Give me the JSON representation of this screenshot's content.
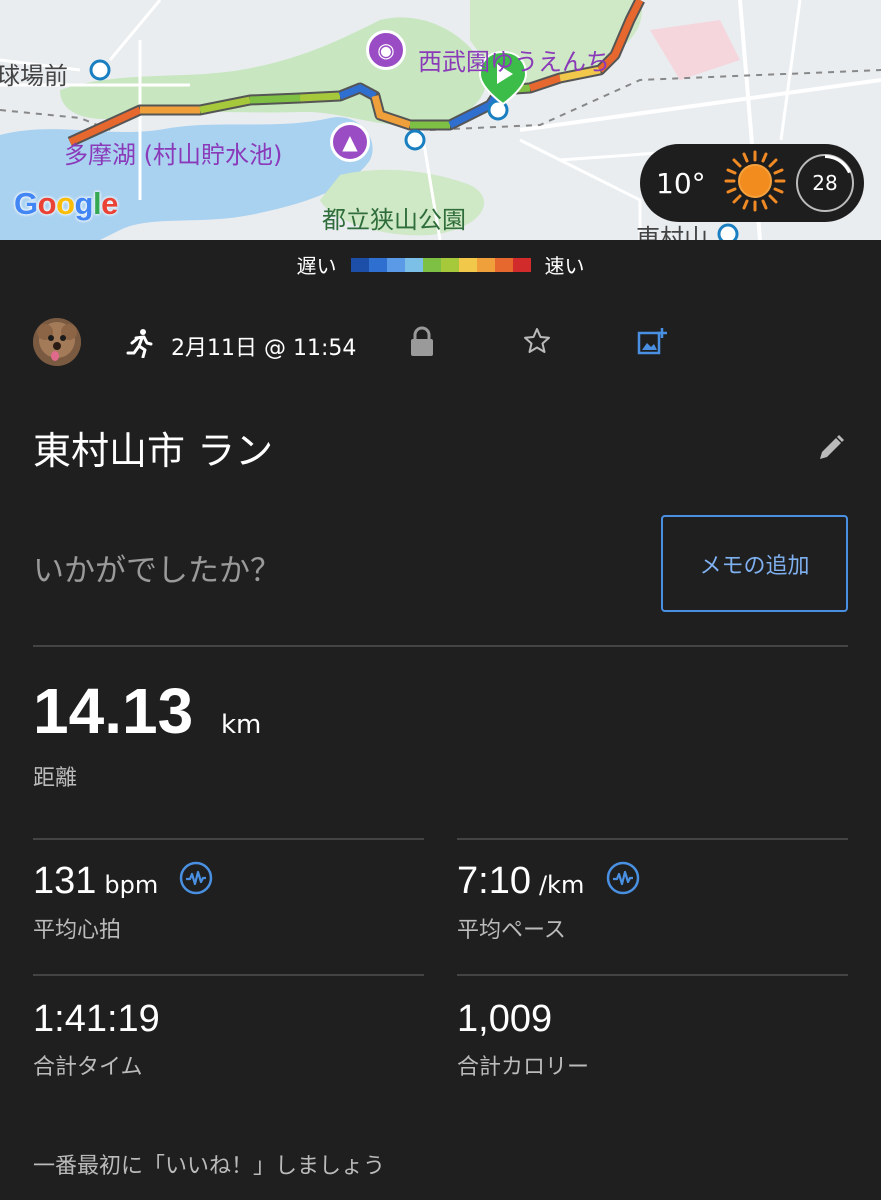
{
  "map": {
    "labels": {
      "kyujo": "球場前",
      "seibuen": "西武園ゆうえんち",
      "tamako": "多摩湖 (村山貯水池)",
      "sayama_park": "都立狭山公園",
      "higashimurayama": "東村山"
    },
    "google_logo": "Google",
    "weather": {
      "temperature": "10°",
      "icon": "sun-icon",
      "gauge_value": "28"
    }
  },
  "legend": {
    "slow": "遅い",
    "fast": "速い",
    "colors": [
      "#1d4fa8",
      "#2f6fcf",
      "#5b9ae6",
      "#7cc0e8",
      "#7dc043",
      "#a5c93b",
      "#f2c84a",
      "#f0a03a",
      "#e6682e",
      "#d12b2b"
    ]
  },
  "activity": {
    "type_icon": "running-icon",
    "date": "2月11日 @ 11:54",
    "title": "東村山市 ラン",
    "prompt": "いかがでしたか？",
    "memo_button": "メモの追加"
  },
  "stats": {
    "distance": {
      "value": "14.13",
      "unit": "km",
      "label": "距離"
    },
    "avg_hr": {
      "value": "131",
      "unit": "bpm",
      "label": "平均心拍"
    },
    "avg_pace": {
      "value": "7:10",
      "unit": "/km",
      "label": "平均ペース"
    },
    "total_time": {
      "value": "1:41:19",
      "label": "合計タイム"
    },
    "total_calories": {
      "value": "1,009",
      "label": "合計カロリー"
    }
  },
  "footer": {
    "text": "一番最初に「いいね！」しましょう"
  }
}
